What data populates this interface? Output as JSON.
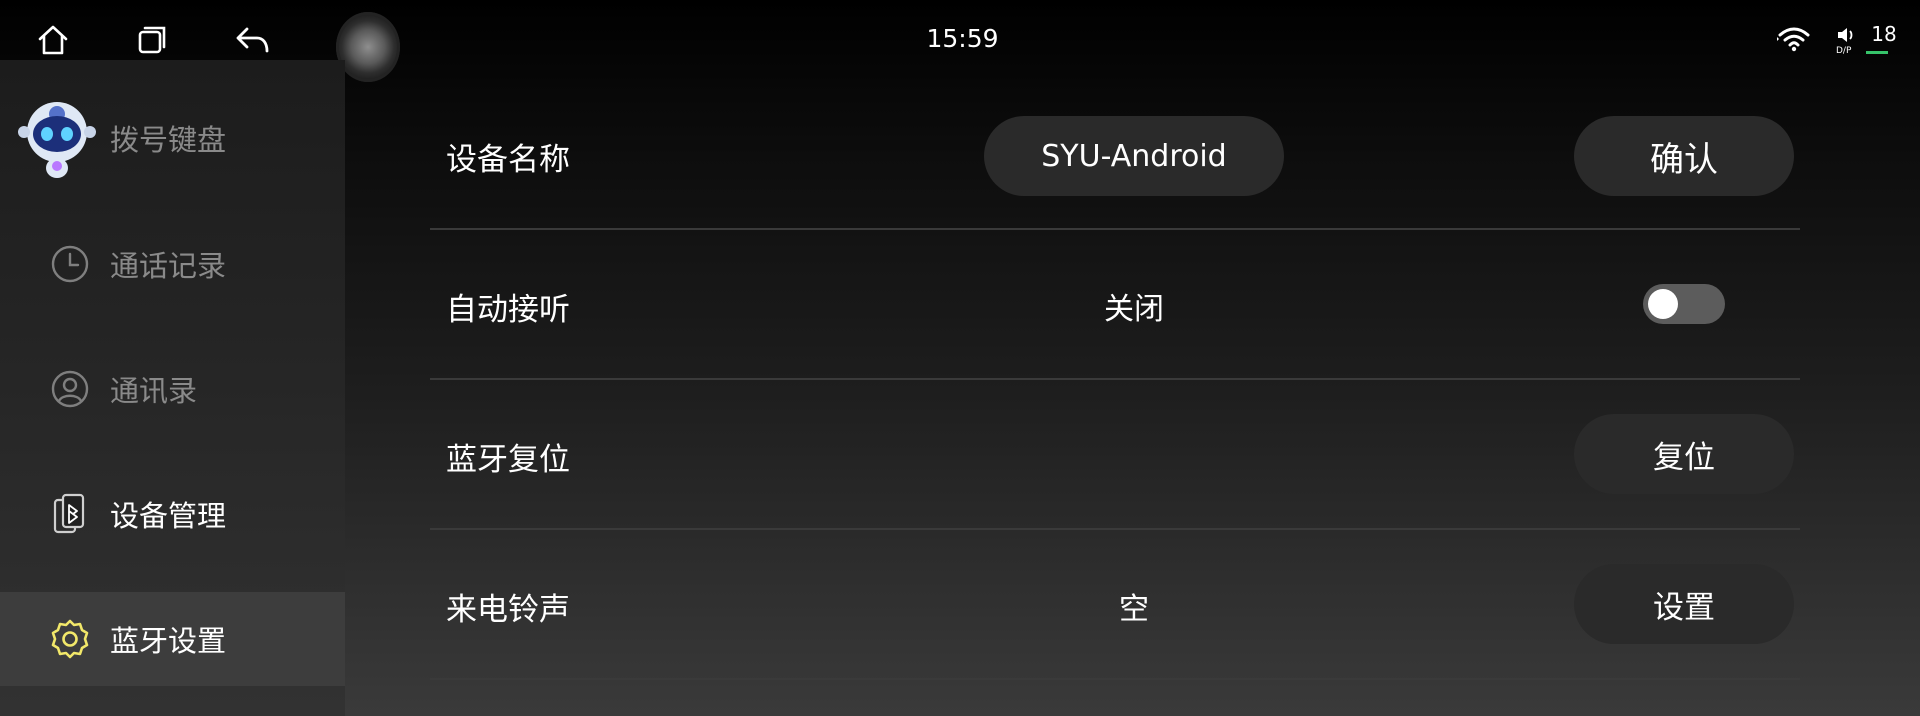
{
  "statusbar": {
    "time": "15:59",
    "dsp_label": "D/P",
    "volume": "18",
    "icons": [
      "home-icon",
      "recent-apps-icon",
      "back-icon",
      "assistive-ball",
      "wifi-icon",
      "speaker-dsp-icon"
    ]
  },
  "sidebar": {
    "items": [
      {
        "label": "拨号键盘",
        "icon": "dialpad-robot-icon"
      },
      {
        "label": "通话记录",
        "icon": "clock-icon"
      },
      {
        "label": "通讯录",
        "icon": "contact-icon"
      },
      {
        "label": "设备管理",
        "icon": "bluetooth-device-icon"
      },
      {
        "label": "蓝牙设置",
        "icon": "gear-icon",
        "selected": true
      }
    ]
  },
  "settings": {
    "device_name": {
      "label": "设备名称",
      "value": "SYU-Android",
      "button": "确认"
    },
    "auto_answer": {
      "label": "自动接听",
      "value": "关闭",
      "toggle_on": false
    },
    "bt_reset": {
      "label": "蓝牙复位",
      "button": "复位"
    },
    "ringtone": {
      "label": "来电铃声",
      "value": "空",
      "button": "设置"
    }
  },
  "colors": {
    "accent_icon": "#f2e86a",
    "pill_bg": "#2a2a2a",
    "toggle_off": "#5c5c5c",
    "volume_indicator": "#36c36a"
  }
}
